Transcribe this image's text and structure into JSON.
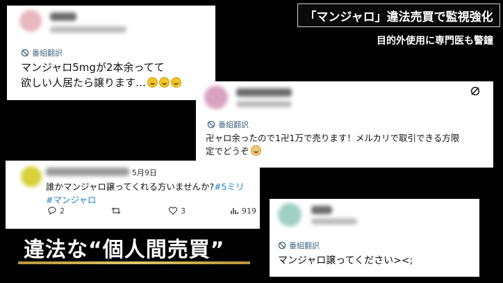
{
  "header": {
    "title": "「マンジャロ」違法売買で監視強化",
    "subtitle": "目的外使用に専門医も警鐘"
  },
  "caption": {
    "text": "違法な“個人間売買”"
  },
  "cards": [
    {
      "translate_label": "番組翻訳",
      "text_line1": "マンジャロ5mgが2本余ってて",
      "text_line2": "欲しい人居たら譲ります…",
      "emoji_icon": "slightly-smiling-face-icon"
    },
    {
      "translate_label": "番組翻訳",
      "text_line1": "卍ャロ余ったので1卍1万で売ります！メルカリで取引できる方限",
      "text_line2": "定でどうぞ",
      "emoji_icon": "person-emoji-icon",
      "top_icon": "sync-icon"
    },
    {
      "date": "5月9日",
      "text_line1": "誰かマンジャロ譲ってくれる方いませんか?",
      "text_hash1": "#5ミリ",
      "text_hash2": "#マンジャロ",
      "replies": "2",
      "retweets": "",
      "likes": "3",
      "views": "919"
    },
    {
      "translate_label": "番組翻訳",
      "text_line1": "マンジャロ譲ってください><;"
    }
  ],
  "colors": {
    "accent_blue": "#1d7ec9",
    "translate": "#4a6b86",
    "gold": "#d8b95a"
  }
}
